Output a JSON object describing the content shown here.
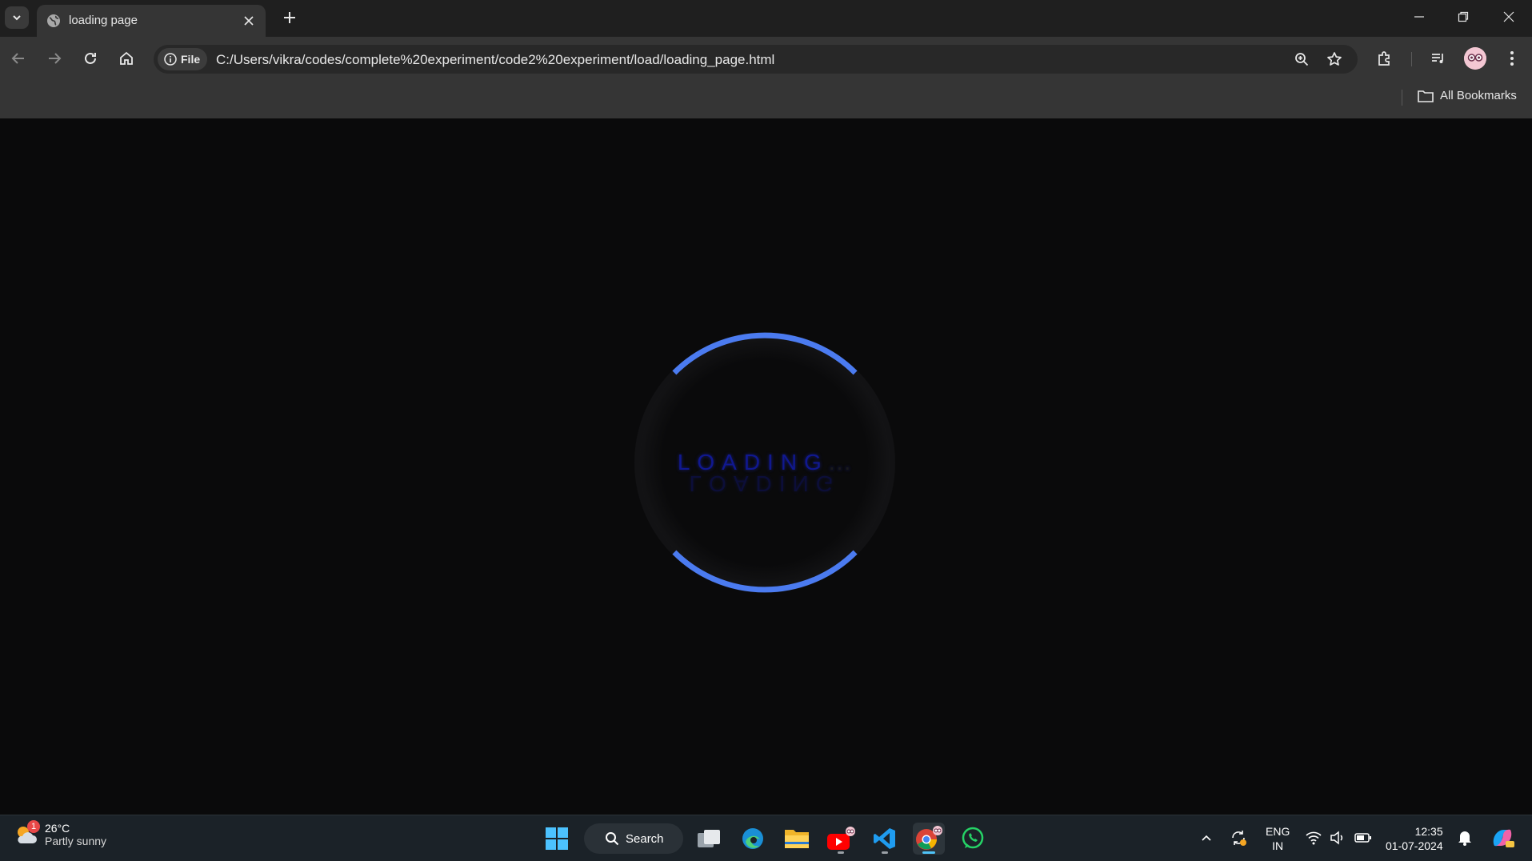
{
  "browser": {
    "tab": {
      "title": "loading page"
    },
    "omnibox": {
      "chip_label": "File",
      "url": "C:/Users/vikra/codes/complete%20experiment/code2%20experiment/load/loading_page.html"
    },
    "bookmarks": {
      "all_label": "All Bookmarks"
    }
  },
  "page": {
    "loader": {
      "text": "LOADING",
      "dots": "...",
      "arc_color": "#4b7bf0",
      "text_color": "#10188f"
    }
  },
  "taskbar": {
    "weather": {
      "temp": "26°C",
      "condition": "Partly sunny",
      "badge": "1"
    },
    "search": {
      "label": "Search"
    },
    "language": {
      "line1": "ENG",
      "line2": "IN"
    },
    "clock": {
      "time": "12:35",
      "date": "01-07-2024"
    }
  }
}
